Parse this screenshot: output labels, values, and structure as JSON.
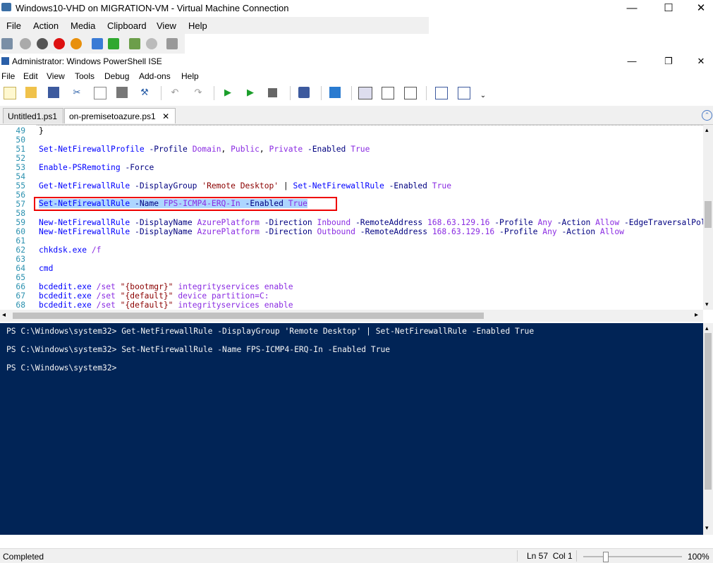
{
  "vm": {
    "title": "Windows10-VHD on MIGRATION-VM - Virtual Machine Connection",
    "menu": [
      "File",
      "Action",
      "Media",
      "Clipboard",
      "View",
      "Help"
    ],
    "controls": {
      "minimize": "—",
      "maximize": "☐",
      "close": "✕"
    }
  },
  "ise": {
    "title": "Administrator: Windows PowerShell ISE",
    "menu": [
      "File",
      "Edit",
      "View",
      "Tools",
      "Debug",
      "Add-ons",
      "Help"
    ],
    "controls": {
      "minimize": "—",
      "restore": "❐",
      "close": "✕"
    }
  },
  "tabs": [
    {
      "label": "Untitled1.ps1"
    },
    {
      "label": "on-premisetoazure.ps1",
      "close": "✕"
    }
  ],
  "editor": {
    "lines": [
      {
        "n": "49",
        "text": "}"
      },
      {
        "n": "50",
        "text": ""
      },
      {
        "n": "51",
        "text": "Set-NetFirewallProfile -Profile Domain, Public, Private -Enabled True"
      },
      {
        "n": "52",
        "text": ""
      },
      {
        "n": "53",
        "text": "Enable-PSRemoting -Force"
      },
      {
        "n": "54",
        "text": ""
      },
      {
        "n": "55",
        "text": "Get-NetFirewallRule -DisplayGroup 'Remote Desktop' | Set-NetFirewallRule -Enabled True"
      },
      {
        "n": "56",
        "text": ""
      },
      {
        "n": "57",
        "text": "Set-NetFirewallRule -Name FPS-ICMP4-ERQ-In -Enabled True"
      },
      {
        "n": "58",
        "text": ""
      },
      {
        "n": "59",
        "text": "New-NetFirewallRule -DisplayName AzurePlatform -Direction Inbound -RemoteAddress 168.63.129.16 -Profile Any -Action Allow -EdgeTraversalPolicy Allow"
      },
      {
        "n": "60",
        "text": "New-NetFirewallRule -DisplayName AzurePlatform -Direction Outbound -RemoteAddress 168.63.129.16 -Profile Any -Action Allow"
      },
      {
        "n": "61",
        "text": ""
      },
      {
        "n": "62",
        "text": "chkdsk.exe /f"
      },
      {
        "n": "63",
        "text": ""
      },
      {
        "n": "64",
        "text": "cmd"
      },
      {
        "n": "65",
        "text": ""
      },
      {
        "n": "66",
        "text": "bcdedit.exe /set \"{bootmgr}\" integrityservices enable"
      },
      {
        "n": "67",
        "text": "bcdedit.exe /set \"{default}\" device partition=C:"
      },
      {
        "n": "68",
        "text": "bcdedit.exe /set \"{default}\" integrityservices enable"
      }
    ]
  },
  "console": {
    "lines": [
      "PS C:\\Windows\\system32> Get-NetFirewallRule -DisplayGroup 'Remote Desktop' | Set-NetFirewallRule -Enabled True",
      "",
      "PS C:\\Windows\\system32> Set-NetFirewallRule -Name FPS-ICMP4-ERQ-In -Enabled True",
      "",
      "PS C:\\Windows\\system32>"
    ]
  },
  "status": {
    "text": "Completed",
    "position": "Ln 57  Col 1",
    "zoom": "100%"
  },
  "colors": {
    "console_bg": "#012456",
    "highlight_box": "#e00000",
    "selection": "#add6ff"
  }
}
